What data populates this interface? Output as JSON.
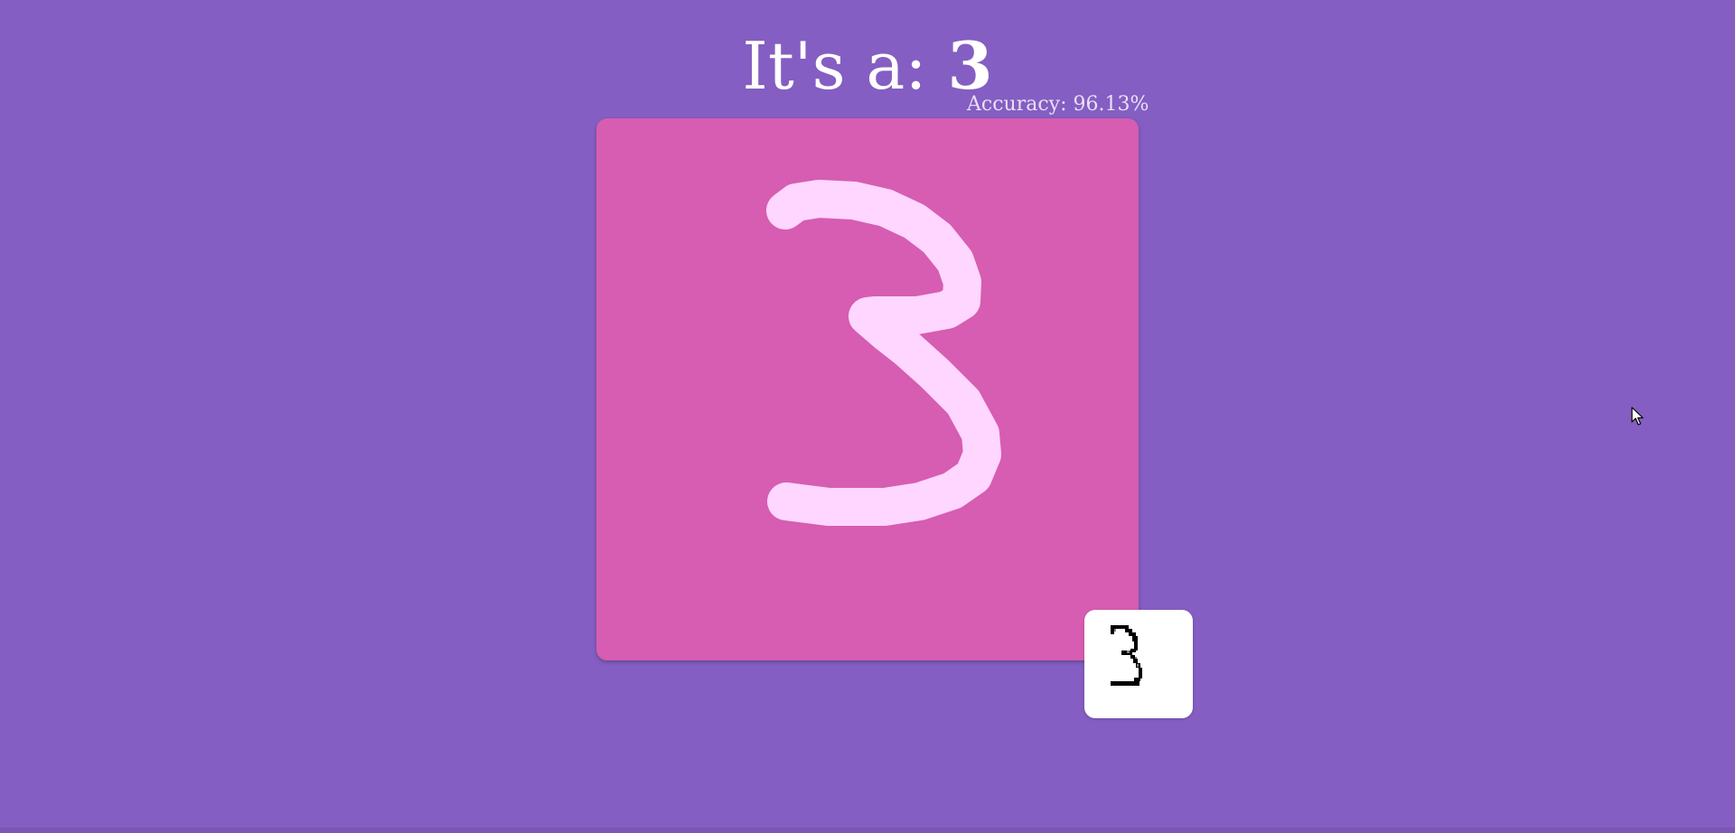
{
  "prediction": {
    "prefix": "It's a: ",
    "digit": "3"
  },
  "accuracy": {
    "text": "Accuracy: 96.13%"
  },
  "colors": {
    "background": "#845ec2",
    "canvas": "#d65db1",
    "stroke": "#ffd6ff",
    "preview_background": "#ffffff",
    "preview_ink": "#000000"
  },
  "icons": {
    "cursor": "mouse-pointer-icon"
  }
}
